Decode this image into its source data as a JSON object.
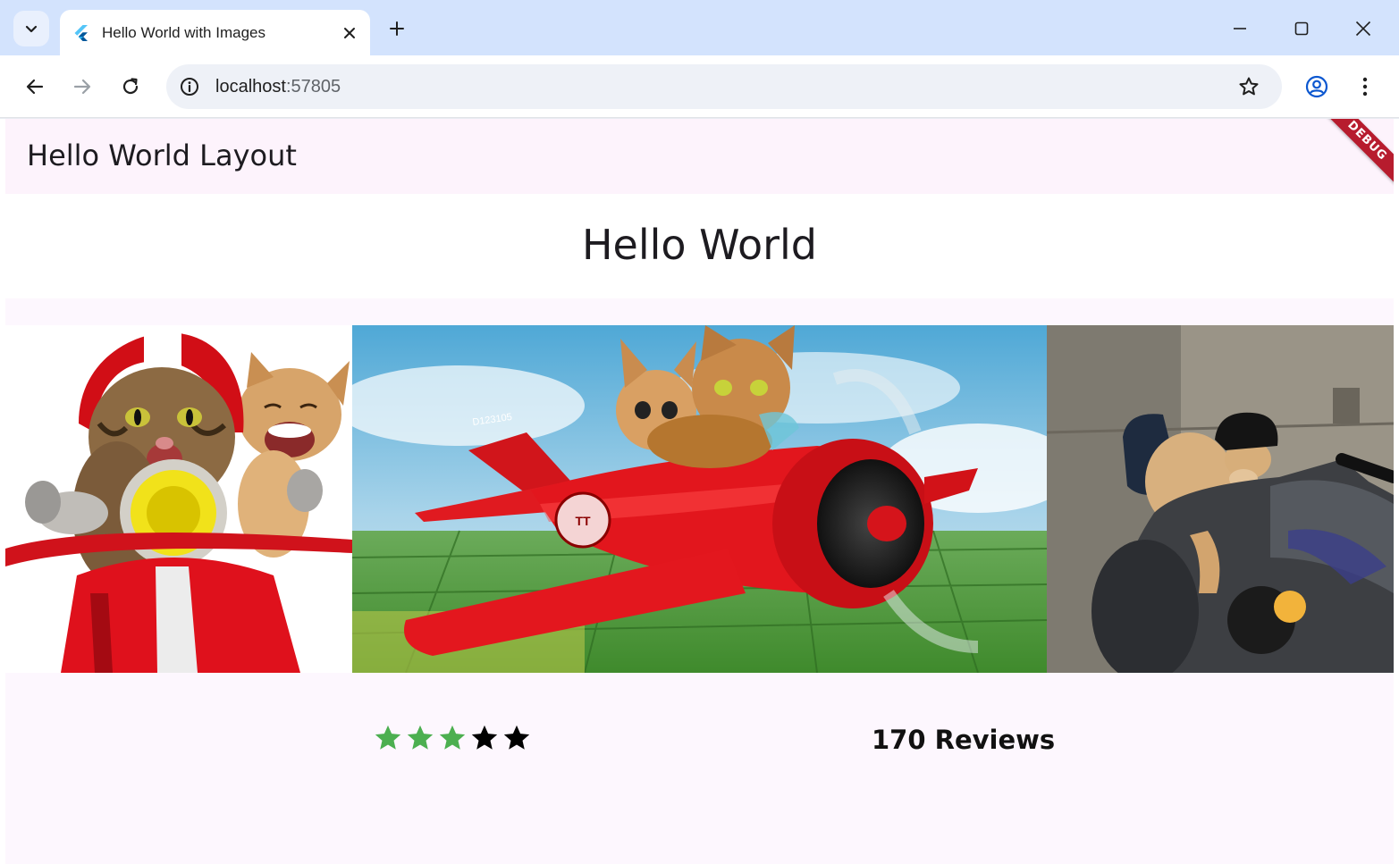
{
  "browser": {
    "tab_title": "Hello World with Images",
    "url_host": "localhost",
    "url_port": ":57805",
    "icons": {
      "tab_search": "chevron-down-icon",
      "favicon": "flutter-icon",
      "tab_close": "close-icon",
      "new_tab": "plus-icon",
      "minimize": "minimize-icon",
      "maximize": "maximize-icon",
      "close_window": "close-icon",
      "back": "arrow-left-icon",
      "forward": "arrow-right-icon",
      "reload": "reload-icon",
      "site_info": "info-icon",
      "bookmark": "star-outline-icon",
      "profile": "account-circle-icon",
      "menu": "more-vert-icon"
    }
  },
  "app": {
    "appbar_title": "Hello World Layout",
    "debug_banner": "DEBUG",
    "heading": "Hello World",
    "images": [
      {
        "name": "cats-on-scooter-image"
      },
      {
        "name": "cats-in-red-airplane-image"
      },
      {
        "name": "cat-riding-motorbike-image"
      }
    ],
    "rating": {
      "stars_total": 5,
      "stars_filled": 3,
      "filled_color": "#4caf50",
      "empty_color": "#000000"
    },
    "reviews_text": "170 Reviews"
  }
}
